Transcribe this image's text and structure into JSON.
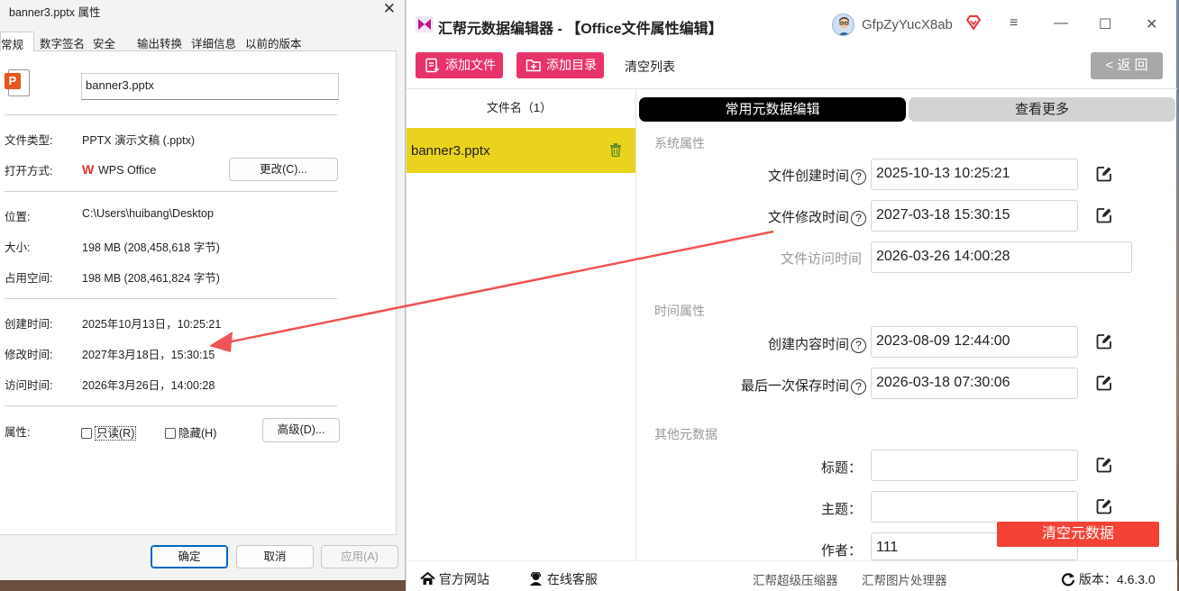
{
  "props": {
    "title": "banner3.pptx 属性",
    "close": "✕",
    "tabs": [
      "常规",
      "数字签名",
      "安全",
      "输出转换",
      "详细信息",
      "以前的版本"
    ],
    "filename": "banner3.pptx",
    "rows": {
      "type_label": "文件类型:",
      "type_value": "PPTX 演示文稿 (.pptx)",
      "open_label": "打开方式:",
      "open_value": "WPS Office",
      "change_btn": "更改(C)...",
      "loc_label": "位置:",
      "loc_value": "C:\\Users\\huibang\\Desktop",
      "size_label": "大小:",
      "size_value": "198 MB (208,458,618 字节)",
      "disk_label": "占用空间:",
      "disk_value": "198 MB (208,461,824 字节)",
      "created_label": "创建时间:",
      "created_value": "2025年10月13日，10:25:21",
      "modified_label": "修改时间:",
      "modified_value": "2027年3月18日，15:30:15",
      "accessed_label": "访问时间:",
      "accessed_value": "2026年3月26日，14:00:28",
      "attr_label": "属性:",
      "readonly": "只读(R)",
      "hidden": "隐藏(H)",
      "advanced_btn": "高级(D)..."
    },
    "buttons": {
      "ok": "确定",
      "cancel": "取消",
      "apply": "应用(A)"
    }
  },
  "app": {
    "title": "汇帮元数据编辑器 - 【Office文件属性编辑】",
    "username": "GfpZyYucX8ab",
    "win": {
      "menu": "≡",
      "minimize": "—",
      "maximize": "☐",
      "close": "✕"
    },
    "toolbar": {
      "add_file": "添加文件",
      "add_dir": "添加目录",
      "clear_list": "清空列表",
      "back": "返 回",
      "back_chevron": "<"
    },
    "file_list": {
      "header": "文件名（1）",
      "files": [
        "banner3.pptx"
      ]
    },
    "tabs": {
      "common": "常用元数据编辑",
      "more": "查看更多"
    },
    "sections": {
      "system": "系统属性",
      "time": "时间属性",
      "other": "其他元数据"
    },
    "fields": {
      "created_label": "文件创建时间",
      "created_value": "2025-10-13 10:25:21",
      "modified_label": "文件修改时间",
      "modified_value": "2027-03-18 15:30:15",
      "accessed_label": "文件访问时间",
      "accessed_value": "2026-03-26 14:00:28",
      "content_created_label": "创建内容时间",
      "content_created_value": "2023-08-09 12:44:00",
      "last_saved_label": "最后一次保存时间",
      "last_saved_value": "2026-03-18 07:30:06",
      "title_label": "标题：",
      "title_value": "",
      "subject_label": "主题：",
      "subject_value": "",
      "author_label": "作者：",
      "author_value": "111",
      "help": "?",
      "colon": "："
    },
    "clear_meta": "清空元数据",
    "footer": {
      "website": "官方网站",
      "service": "在线客服",
      "compressor": "汇帮超级压缩器",
      "image_tool": "汇帮图片处理器",
      "version": "版本：4.6.3.0"
    },
    "colors": {
      "accent": "#e8336a",
      "selected_row": "#ead31c",
      "danger": "#f44336",
      "annotation_arrow": "#f05454"
    }
  }
}
